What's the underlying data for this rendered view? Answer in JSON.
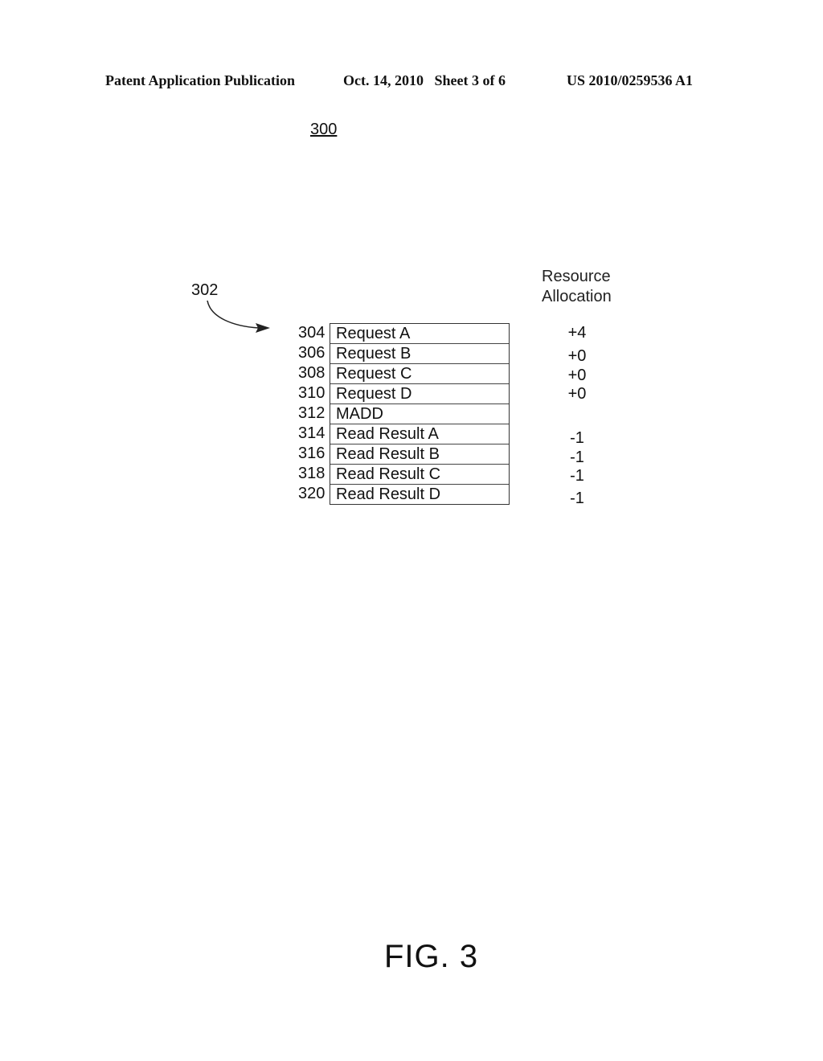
{
  "header": {
    "publication": "Patent Application Publication",
    "date_sheet": "Oct. 14, 2010   Sheet 3 of 6",
    "number": "US 2010/0259536 A1"
  },
  "figure_ref": "300",
  "pointer_ref": "302",
  "column_header": {
    "line1": "Resource",
    "line2": "Allocation"
  },
  "rows": [
    {
      "id": "304",
      "label": "Request A",
      "allocation": "+4"
    },
    {
      "id": "306",
      "label": "Request B",
      "allocation": "+0"
    },
    {
      "id": "308",
      "label": "Request C",
      "allocation": "+0"
    },
    {
      "id": "310",
      "label": "Request D",
      "allocation": "+0"
    },
    {
      "id": "312",
      "label": "MADD",
      "allocation": ""
    },
    {
      "id": "314",
      "label": "Read Result A",
      "allocation": "-1"
    },
    {
      "id": "316",
      "label": "Read Result B",
      "allocation": "-1"
    },
    {
      "id": "318",
      "label": "Read Result C",
      "allocation": "-1"
    },
    {
      "id": "320",
      "label": "Read Result D",
      "allocation": "-1"
    }
  ],
  "caption": "FIG. 3"
}
